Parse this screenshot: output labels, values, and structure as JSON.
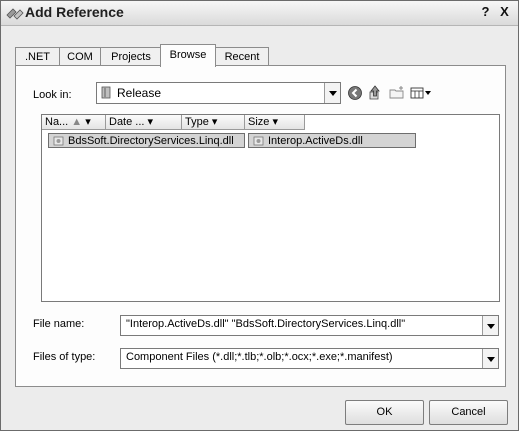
{
  "window": {
    "title": "Add Reference",
    "help_label": "?",
    "close_label": "X"
  },
  "tabs": [
    {
      "label": ".NET"
    },
    {
      "label": "COM"
    },
    {
      "label": "Projects"
    },
    {
      "label": "Browse"
    },
    {
      "label": "Recent"
    }
  ],
  "active_tab": "Browse",
  "browse": {
    "look_in_label": "Look in:",
    "look_in_value": "Release",
    "toolbar_icons": [
      "back-icon",
      "up-folder-icon",
      "new-folder-icon",
      "view-menu-icon"
    ],
    "columns": [
      {
        "label": "Na... "
      },
      {
        "label": "Date ..."
      },
      {
        "label": "Type"
      },
      {
        "label": "Size"
      }
    ],
    "files": [
      {
        "name": "BdsSoft.DirectoryServices.Linq.dll",
        "selected": true
      },
      {
        "name": "Interop.ActiveDs.dll",
        "selected": true
      }
    ],
    "file_name_label": "File name:",
    "file_name_value": "\"Interop.ActiveDs.dll\" \"BdsSoft.DirectoryServices.Linq.dll\"",
    "file_type_label": "Files of type:",
    "file_type_value": "Component Files (*.dll;*.tlb;*.olb;*.ocx;*.exe;*.manifest)"
  },
  "buttons": {
    "ok": "OK",
    "cancel": "Cancel"
  },
  "colors": {
    "dialog_bg": "#ececec",
    "selection": "#d4d4d4",
    "border": "#7a7a7a"
  }
}
